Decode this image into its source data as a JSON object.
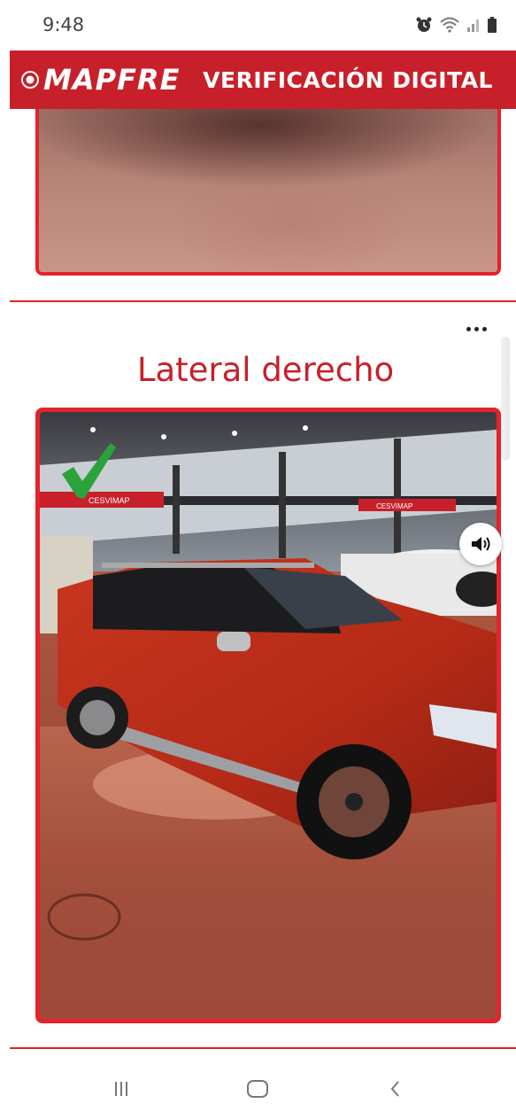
{
  "status_bar": {
    "time": "9:48",
    "icons": [
      "alarm-icon",
      "wifi-icon",
      "signal-icon",
      "battery-icon"
    ]
  },
  "header": {
    "brand": "MAPFRE",
    "title": "VERIFICACIÓN DIGITAL"
  },
  "section": {
    "title": "Lateral derecho"
  },
  "photo": {
    "status_icon": "check-icon",
    "signage": [
      "CESVIMAP",
      "CESVIMAP"
    ]
  },
  "controls": {
    "overflow_icon": "more-horizontal-icon",
    "sound_icon": "volume-icon"
  },
  "navigation": {
    "buttons": [
      "recent-apps-icon",
      "home-icon",
      "back-icon"
    ]
  },
  "colors": {
    "brand_red": "#c8202a",
    "accent_red": "#e4232b",
    "check_green": "#2aa33b"
  }
}
